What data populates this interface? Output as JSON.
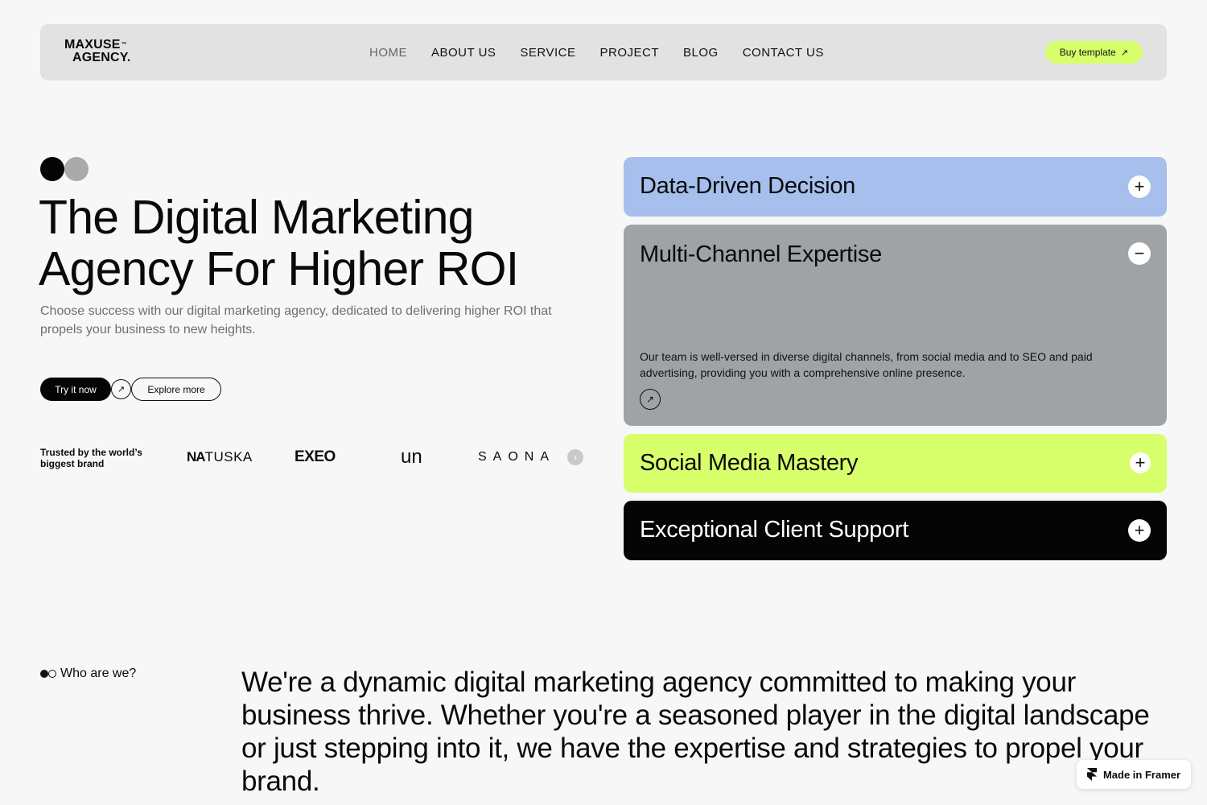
{
  "nav": {
    "logo_line1": "MAXUSE",
    "logo_tm": "™",
    "logo_line2": "AGENCY.",
    "items": [
      "HOME",
      "ABOUT US",
      "SERVICE",
      "PROJECT",
      "BLOG",
      "CONTACT US"
    ],
    "active_item": "HOME",
    "buy_label": "Buy template",
    "buy_icon": "arrow-up-right-icon"
  },
  "hero": {
    "title": "The Digital Marketing Agency For Higher ROI",
    "subtitle": "Choose success with our digital marketing agency, dedicated to delivering higher ROI that propels your business to new heights.",
    "try_label": "Try it now",
    "explore_label": "Explore more",
    "trusted_label": "Trusted by the world’s biggest brand",
    "brands": [
      "NATUSKA",
      "EXEO",
      "un",
      "SAONA"
    ]
  },
  "accordion": [
    {
      "title": "Data-Driven Decision",
      "state": "collapsed",
      "color": "#a6bfec"
    },
    {
      "title": "Multi-Channel Expertise",
      "state": "expanded",
      "color": "#a0a3a6",
      "description": "Our team is well-versed in diverse digital channels, from social media and to SEO and paid advertising, providing you with a comprehensive online presence."
    },
    {
      "title": "Social Media Mastery",
      "state": "collapsed",
      "color": "#d6ff6b"
    },
    {
      "title": "Exceptional Client Support",
      "state": "collapsed",
      "color": "#050505"
    }
  ],
  "who": {
    "label": "Who are we?",
    "text": "We're a dynamic digital marketing agency committed to making your business thrive. Whether you're a seasoned player in the digital landscape or just stepping into it, we have the expertise and strategies to propel your brand."
  },
  "framer_badge": "Made in Framer",
  "colors": {
    "accent": "#d6ff6b",
    "dark": "#050505",
    "nav_bg": "#e2e2e2"
  }
}
